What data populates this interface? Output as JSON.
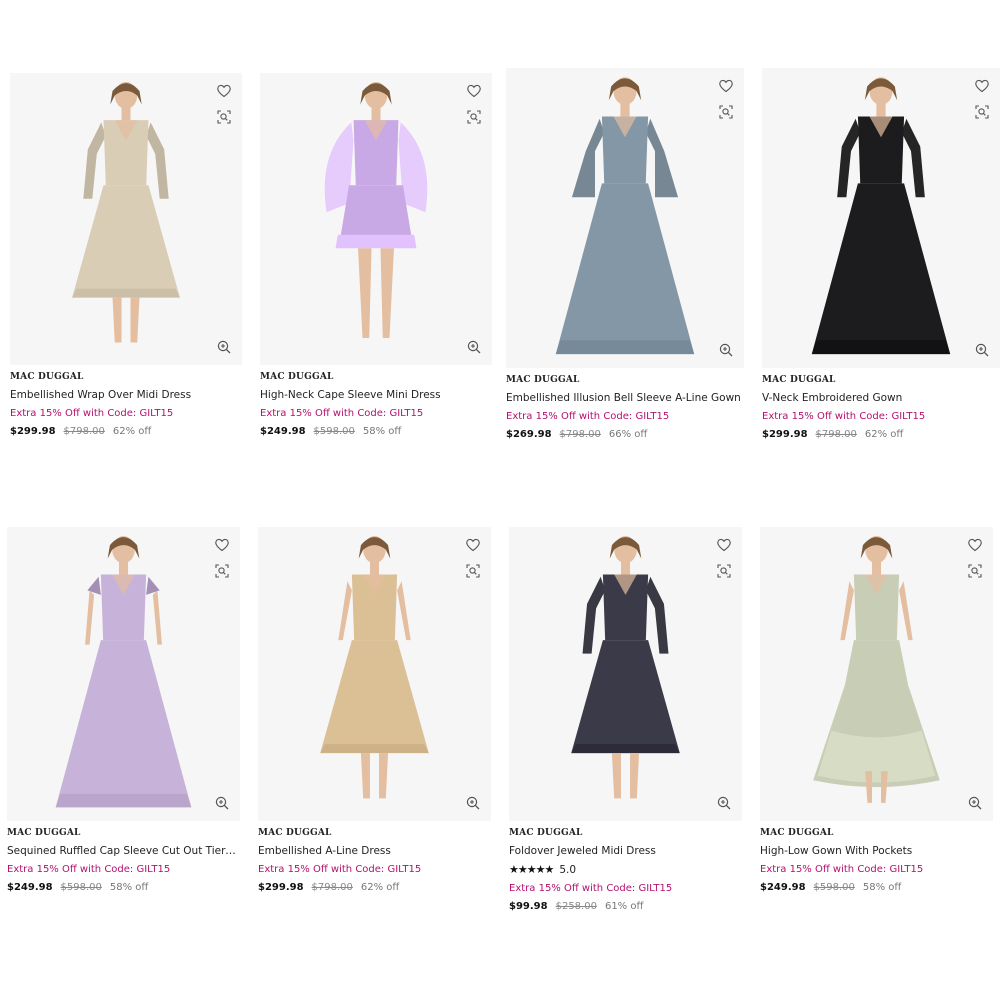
{
  "icons": {
    "wishlist": "heart-icon",
    "visual_search": "scan-icon",
    "quick_view": "zoom-icon"
  },
  "colors": {
    "promo": "#b5106f",
    "image_bg": "#f6f6f6"
  },
  "products": [
    {
      "brand": "MAC DUGGAL",
      "name": "Embellished Wrap Over Midi Dress",
      "promo": "Extra 15% Off with Code: GILT15",
      "price": "$299.98",
      "original_price": "$798.00",
      "discount": "62% off",
      "dress_color": "#d9cdb6",
      "sleeve": "long",
      "length": "midi"
    },
    {
      "brand": "MAC DUGGAL",
      "name": "High-Neck Cape Sleeve Mini Dress",
      "promo": "Extra 15% Off with Code: GILT15",
      "price": "$249.98",
      "original_price": "$598.00",
      "discount": "58% off",
      "dress_color": "#c9a8e6",
      "sleeve": "cape",
      "length": "mini"
    },
    {
      "brand": "MAC DUGGAL",
      "name": "Embellished Illusion Bell Sleeve A-Line Gown",
      "promo": "Extra 15% Off with Code: GILT15",
      "price": "$269.98",
      "original_price": "$798.00",
      "discount": "66% off",
      "dress_color": "#8397a6",
      "sleeve": "bell",
      "length": "gown"
    },
    {
      "brand": "MAC DUGGAL",
      "name": "V-Neck Embroidered Gown",
      "promo": "Extra 15% Off with Code: GILT15",
      "price": "$299.98",
      "original_price": "$798.00",
      "discount": "62% off",
      "dress_color": "#1c1c1f",
      "sleeve": "long",
      "length": "gown"
    },
    {
      "brand": "MAC DUGGAL",
      "name": "Sequined Ruffled Cap Sleeve Cut Out Tiered Gown",
      "promo": "Extra 15% Off with Code: GILT15",
      "price": "$249.98",
      "original_price": "$598.00",
      "discount": "58% off",
      "dress_color": "#c7b3d9",
      "sleeve": "cap",
      "length": "gown"
    },
    {
      "brand": "MAC DUGGAL",
      "name": "Embellished A-Line Dress",
      "promo": "Extra 15% Off with Code: GILT15",
      "price": "$299.98",
      "original_price": "$798.00",
      "discount": "62% off",
      "dress_color": "#dcc095",
      "sleeve": "none",
      "length": "midi"
    },
    {
      "brand": "MAC DUGGAL",
      "name": "Foldover Jeweled Midi Dress",
      "rating_stars": "★★★★★",
      "rating": "5.0",
      "promo": "Extra 15% Off with Code: GILT15",
      "price": "$99.98",
      "original_price": "$258.00",
      "discount": "61% off",
      "dress_color": "#3b3a48",
      "sleeve": "long",
      "length": "midi"
    },
    {
      "brand": "MAC DUGGAL",
      "name": "High-Low Gown With Pockets",
      "promo": "Extra 15% Off with Code: GILT15",
      "price": "$249.98",
      "original_price": "$598.00",
      "discount": "58% off",
      "dress_color": "#c8cdb5",
      "sleeve": "none",
      "length": "hilo"
    }
  ]
}
